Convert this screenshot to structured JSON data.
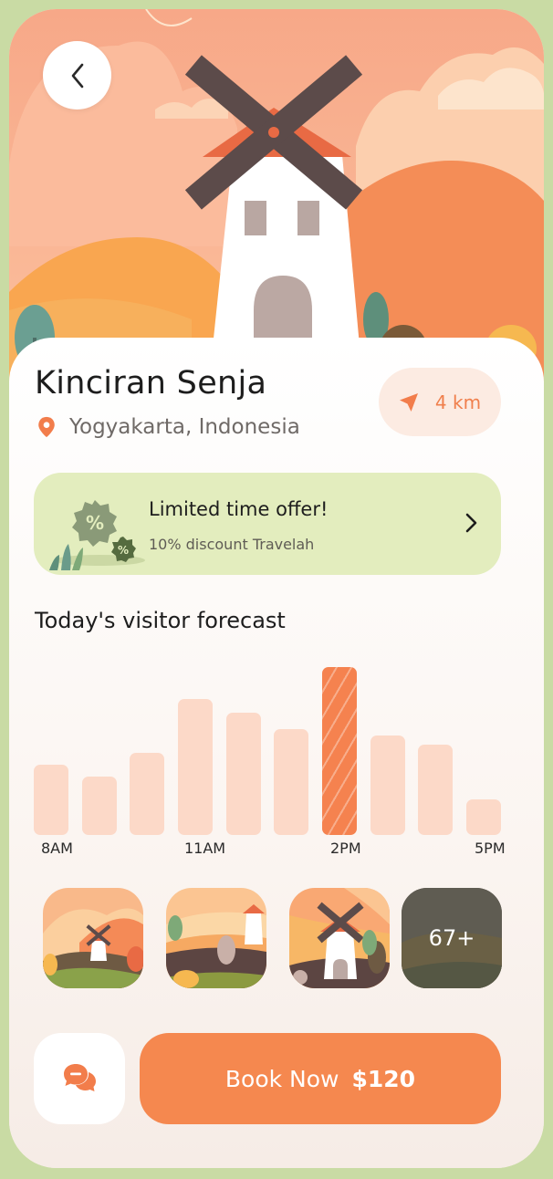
{
  "place": {
    "name": "Kinciran Senja",
    "location": "Yogyakarta, Indonesia",
    "distance": "4 km"
  },
  "offer": {
    "title": "Limited time offer!",
    "subtitle": "10% discount Travelah"
  },
  "forecast": {
    "title": "Today's visitor forecast",
    "tick_labels": [
      "8AM",
      "11AM",
      "2PM",
      "5PM"
    ],
    "bars": [
      0.42,
      0.35,
      0.49,
      0.81,
      0.73,
      0.63,
      1.0,
      0.59,
      0.54,
      0.21
    ],
    "active_index": 6
  },
  "gallery": {
    "more_label": "67+"
  },
  "actions": {
    "book_label": "Book Now",
    "price": "$120"
  },
  "icons": {
    "back": "chevron-left-icon",
    "location": "location-pin-icon",
    "distance": "navigation-arrow-icon",
    "offer_chevron": "chevron-right-icon",
    "chat": "chat-bubbles-icon"
  },
  "colors": {
    "accent": "#f5884f",
    "bar": "#fcd9c8",
    "offer_bg": "#e3edbe",
    "page_bg": "#c9dba4"
  }
}
